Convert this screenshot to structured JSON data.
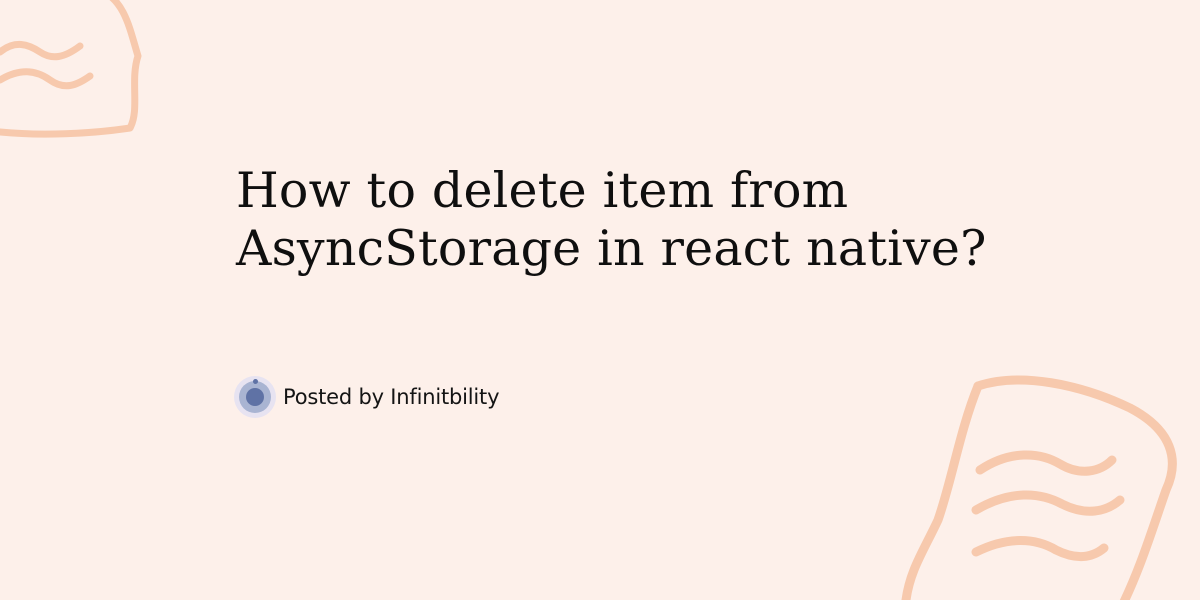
{
  "post": {
    "title": "How to delete item from AsyncStorage in react native?",
    "byline": "Posted by Infinitbility"
  },
  "colors": {
    "background": "#fdf0ea",
    "decoration": "#f7c9ad",
    "title_text": "#0f0f0f",
    "avatar_outer": "#e7e3f1",
    "avatar_ring": "#a9b4d2",
    "avatar_core": "#5f72a5"
  },
  "icons": {
    "avatar": "author-avatar-icon",
    "decoration": "speech-bubble-doodle-icon"
  }
}
